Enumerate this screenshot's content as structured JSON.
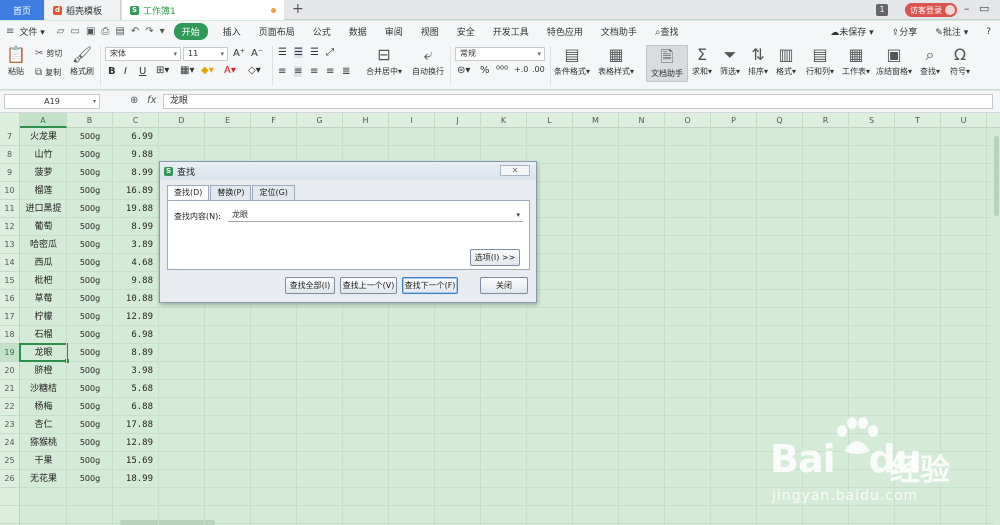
{
  "tabs": {
    "home": "首页",
    "template": "稻壳模板",
    "workbook": "工作簿1",
    "tab_count": "1",
    "login": "访客登录"
  },
  "menu": {
    "file": "文件",
    "items": [
      "开始",
      "插入",
      "页面布局",
      "公式",
      "数据",
      "审阅",
      "视图",
      "安全",
      "开发工具",
      "特色应用",
      "文档助手",
      "查找"
    ],
    "unsaved": "未保存",
    "share": "分享",
    "comment": "批注"
  },
  "ribbon": {
    "paste": "粘贴",
    "cut": "剪切",
    "copy": "复制",
    "format_painter": "格式刷",
    "font_name": "宋体",
    "font_size": "11",
    "merge_center": "合并居中",
    "wrap_text": "自动换行",
    "number_format": "常规",
    "conditional_format": "条件格式",
    "table_style": "表格样式",
    "doc_helper": "文档助手",
    "sum": "求和",
    "filter": "筛选",
    "sort": "排序",
    "format": "格式",
    "row_col": "行和列",
    "worksheet": "工作表",
    "freeze": "冻结窗格",
    "find": "查找",
    "symbol": "符号"
  },
  "formula_bar": {
    "name_box": "A19",
    "content": "龙眼"
  },
  "columns": [
    "A",
    "B",
    "C",
    "D",
    "E",
    "F",
    "G",
    "H",
    "I",
    "J",
    "K",
    "L",
    "M",
    "N",
    "O",
    "P",
    "Q",
    "R",
    "S",
    "T",
    "U"
  ],
  "rows": [
    {
      "num": "7",
      "name": "火龙果",
      "weight": "500g",
      "price": "6.99"
    },
    {
      "num": "8",
      "name": "山竹",
      "weight": "500g",
      "price": "9.88"
    },
    {
      "num": "9",
      "name": "菠萝",
      "weight": "500g",
      "price": "8.99"
    },
    {
      "num": "10",
      "name": "榴莲",
      "weight": "500g",
      "price": "16.89"
    },
    {
      "num": "11",
      "name": "进口黑提",
      "weight": "500g",
      "price": "19.88"
    },
    {
      "num": "12",
      "name": "葡萄",
      "weight": "500g",
      "price": "8.99"
    },
    {
      "num": "13",
      "name": "哈密瓜",
      "weight": "500g",
      "price": "3.89"
    },
    {
      "num": "14",
      "name": "西瓜",
      "weight": "500g",
      "price": "4.68"
    },
    {
      "num": "15",
      "name": "枇杷",
      "weight": "500g",
      "price": "9.88"
    },
    {
      "num": "16",
      "name": "草莓",
      "weight": "500g",
      "price": "10.88"
    },
    {
      "num": "17",
      "name": "柠檬",
      "weight": "500g",
      "price": "12.89"
    },
    {
      "num": "18",
      "name": "石榴",
      "weight": "500g",
      "price": "6.98"
    },
    {
      "num": "19",
      "name": "龙眼",
      "weight": "500g",
      "price": "8.89"
    },
    {
      "num": "20",
      "name": "脐橙",
      "weight": "500g",
      "price": "3.98"
    },
    {
      "num": "21",
      "name": "沙糖桔",
      "weight": "500g",
      "price": "5.68"
    },
    {
      "num": "22",
      "name": "杨梅",
      "weight": "500g",
      "price": "6.88"
    },
    {
      "num": "23",
      "name": "杏仁",
      "weight": "500g",
      "price": "17.88"
    },
    {
      "num": "24",
      "name": "猕猴桃",
      "weight": "500g",
      "price": "12.89"
    },
    {
      "num": "25",
      "name": "干果",
      "weight": "500g",
      "price": "15.69"
    },
    {
      "num": "26",
      "name": "无花果",
      "weight": "500g",
      "price": "18.99"
    }
  ],
  "active_row": "19",
  "active_col": "A",
  "find_dialog": {
    "title": "查找",
    "tabs": [
      "查找(D)",
      "替换(P)",
      "定位(G)"
    ],
    "active_tab": "查找(D)",
    "find_label": "查找内容(N):",
    "find_value": "龙眼",
    "options_btn": "选项(I) >>",
    "find_all": "查找全部(I)",
    "find_prev": "查找上一个(V)",
    "find_next": "查找下一个(F)",
    "close": "关闭"
  },
  "watermark": {
    "logo": "Bai",
    "logo_suffix": "du",
    "cn": "经验",
    "url": "jingyan.baidu.com"
  },
  "colors": {
    "accent": "#2f9a57",
    "sheet_bg": "#d4ecd7",
    "home_tab": "#3d7ddf",
    "login": "#d9534f"
  }
}
